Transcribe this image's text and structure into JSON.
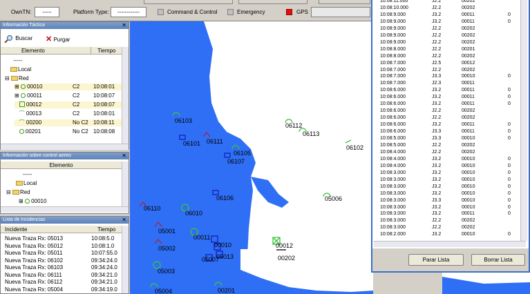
{
  "topbar": {
    "owntn_label": "OwnTN:",
    "owntn_value": "-----",
    "platform_label": "Platform Type:",
    "platform_value": "------------",
    "command_label": "Command & Control",
    "emergency_label": "Emergency",
    "gps_label": "GPS"
  },
  "tactical": {
    "title": "Información Táctica",
    "buscar": "Buscar",
    "purgar": "Purgar",
    "col_elemento": "Elemento",
    "col_tiempo": "Tiempo",
    "rows": [
      {
        "name": "-----",
        "c2": "",
        "time": ""
      },
      {
        "name": "Local",
        "c2": "",
        "time": ""
      },
      {
        "name": "Red",
        "c2": "",
        "time": ""
      },
      {
        "name": "00010",
        "c2": "C2",
        "time": "10:08:01"
      },
      {
        "name": "00011",
        "c2": "C2",
        "time": "10:08:07"
      },
      {
        "name": "00012",
        "c2": "C2",
        "time": "10:08:07"
      },
      {
        "name": "00013",
        "c2": "C2",
        "time": "10:08:01"
      },
      {
        "name": "00200",
        "c2": "No C2",
        "time": "10:08:11"
      },
      {
        "name": "00201",
        "c2": "No C2",
        "time": "10:08:08"
      }
    ]
  },
  "aereo": {
    "title": "Información sobre control aereo",
    "col_elemento": "Elemento",
    "rows": [
      "-----",
      "Local",
      "Red",
      "00010"
    ]
  },
  "incidencias": {
    "title": "Lista de Incidencias",
    "col_incidente": "Incidente",
    "col_tiempo": "Tiempo",
    "rows": [
      {
        "text": "Nueva Traza Rx: 05013",
        "time": "10:08:5.0"
      },
      {
        "text": "Nueva Traza Rx: 05012",
        "time": "10:08:1.0"
      },
      {
        "text": "Nueva Traza Rx: 05011",
        "time": "10:07:55.0"
      },
      {
        "text": "Nueva Traza Rx: 06102",
        "time": "09:34:24.0"
      },
      {
        "text": "Nueva Traza Rx: 06103",
        "time": "09:34:24.0"
      },
      {
        "text": "Nueva Traza Rx: 06111",
        "time": "09:34:21.0"
      },
      {
        "text": "Nueva Traza Rx: 06112",
        "time": "09:34:21.0"
      },
      {
        "text": "Nueva Traza Rx: 05004",
        "time": "09:34:19.0"
      }
    ]
  },
  "map_labels": [
    "06112",
    "06113",
    "06103",
    "06101",
    "06111",
    "06105",
    "06107",
    "06102",
    "06106",
    "05006",
    "06110",
    "06010",
    "05001",
    "05002",
    "00011",
    "00010",
    "05007",
    "05013",
    "00012",
    "00202",
    "05003",
    "05004",
    "00201"
  ],
  "list": {
    "rows": [
      [
        "10:08:11.000",
        "J2.2",
        "00202",
        ""
      ],
      [
        "10:08:10.000",
        "J2.2",
        "00202",
        ""
      ],
      [
        "10:08:9.000",
        "J3.2",
        "00011",
        "0"
      ],
      [
        "10:08:9.000",
        "J3.2",
        "00011",
        "0"
      ],
      [
        "10:08:9.000",
        "J2.2",
        "00202",
        ""
      ],
      [
        "10:08:9.000",
        "J2.2",
        "00202",
        ""
      ],
      [
        "10:08:9.000",
        "J2.2",
        "00202",
        ""
      ],
      [
        "10:08:8.000",
        "J2.2",
        "00201",
        ""
      ],
      [
        "10:08:8.000",
        "J2.2",
        "00202",
        ""
      ],
      [
        "10:08:7.000",
        "J2.5",
        "00012",
        ""
      ],
      [
        "10:08:7.000",
        "J2.2",
        "00202",
        ""
      ],
      [
        "10:08:7.000",
        "J3.3",
        "00010",
        "0"
      ],
      [
        "10:08:7.000",
        "J2.3",
        "00011",
        ""
      ],
      [
        "10:08:6.000",
        "J3.2",
        "00011",
        "0"
      ],
      [
        "10:08:6.000",
        "J3.2",
        "00011",
        "0"
      ],
      [
        "10:08:6.000",
        "J3.2",
        "00011",
        "0"
      ],
      [
        "10:08:6.000",
        "J2.2",
        "00202",
        ""
      ],
      [
        "10:08:6.000",
        "J2.2",
        "00202",
        ""
      ],
      [
        "10:08:6.000",
        "J3.2",
        "00011",
        "0"
      ],
      [
        "10:08:6.000",
        "J3.3",
        "00011",
        "0"
      ],
      [
        "10:08:5.000",
        "J3.3",
        "00010",
        "0"
      ],
      [
        "10:08:5.000",
        "J2.2",
        "00202",
        ""
      ],
      [
        "10:08:4.000",
        "J2.2",
        "00202",
        ""
      ],
      [
        "10:08:4.000",
        "J3.2",
        "00010",
        "0"
      ],
      [
        "10:08:4.000",
        "J3.2",
        "00010",
        "0"
      ],
      [
        "10:08:3.000",
        "J3.2",
        "00010",
        "0"
      ],
      [
        "10:08:3.000",
        "J3.2",
        "00010",
        "0"
      ],
      [
        "10:08:3.000",
        "J3.2",
        "00010",
        "0"
      ],
      [
        "10:08:3.000",
        "J3.2",
        "00010",
        "0"
      ],
      [
        "10:08:3.000",
        "J3.3",
        "00010",
        "0"
      ],
      [
        "10:08:3.000",
        "J3.2",
        "00010",
        "0"
      ],
      [
        "10:08:3.000",
        "J3.2",
        "00011",
        "0"
      ],
      [
        "10:08:3.000",
        "J2.2",
        "00202",
        ""
      ],
      [
        "10:08:3.000",
        "J2.2",
        "00202",
        ""
      ],
      [
        "10:08:2.000",
        "J3.2",
        "00010",
        "0"
      ]
    ],
    "parar": "Parar Lista",
    "borrar": "Borrar Lista"
  }
}
